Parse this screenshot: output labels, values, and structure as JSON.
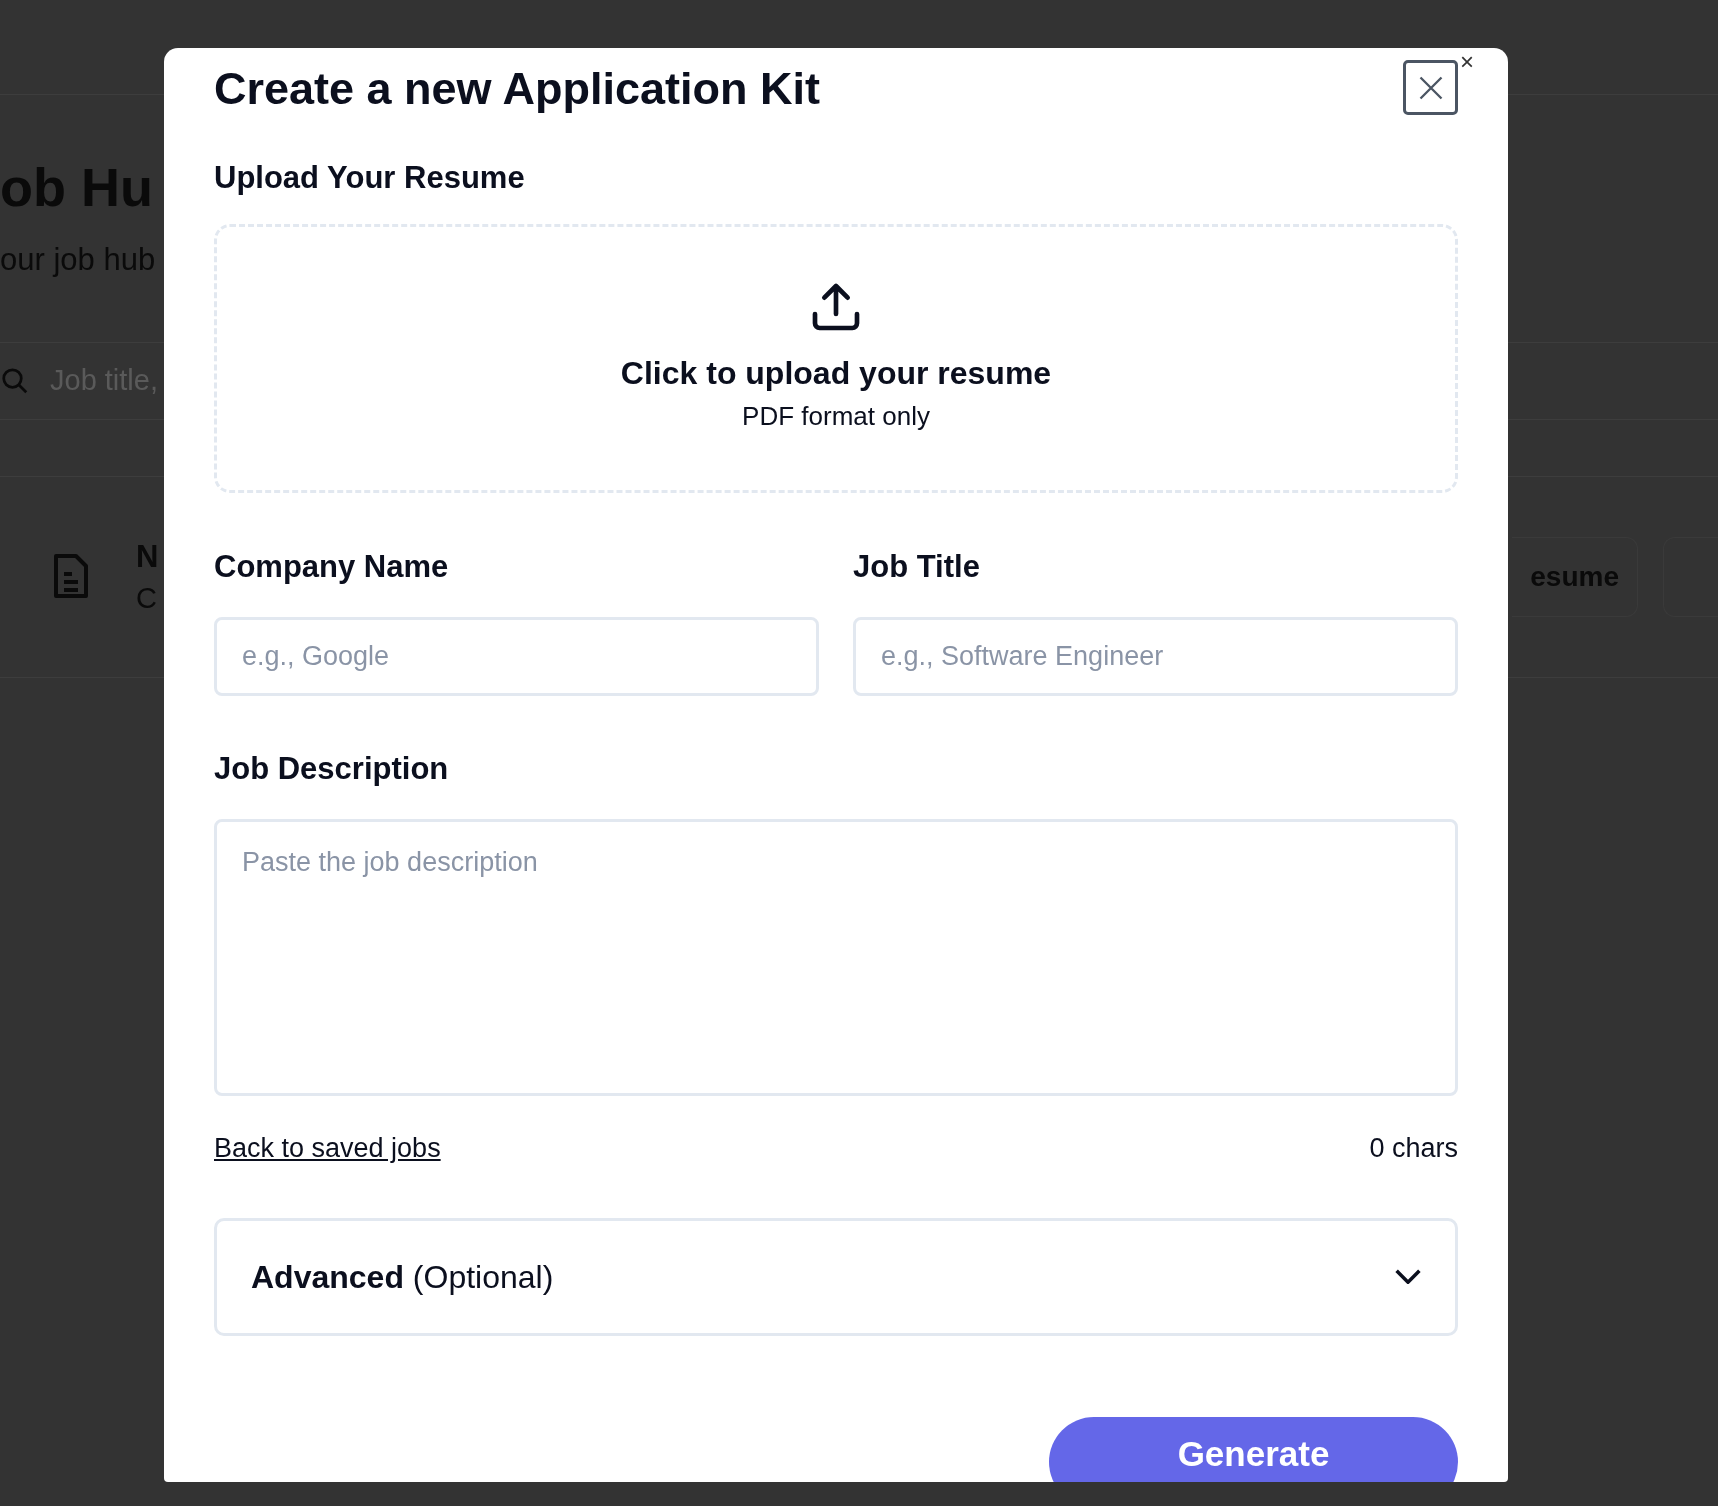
{
  "background_page": {
    "title": "ob Hu",
    "subtitle": "our job hub",
    "search": {
      "placeholder": "Job title,"
    },
    "job_row": {
      "title": "N",
      "subtitle": "C",
      "actions": [
        "esume"
      ]
    }
  },
  "dialog": {
    "title": "Create a new Application Kit",
    "close_label": "×",
    "upload": {
      "heading": "Upload Your Resume",
      "prompt": "Click to upload your resume",
      "hint": "PDF format only"
    },
    "fields": [
      {
        "label": "Company Name",
        "placeholder": "e.g., Google"
      },
      {
        "label": "Job Title",
        "placeholder": "e.g., Software Engineer"
      }
    ],
    "description": {
      "label": "Job Description",
      "placeholder": "Paste the job description"
    },
    "back_link": "Back to saved jobs",
    "char_count": "0 chars",
    "advanced": {
      "label": "**Advanced** (Optional)",
      "expanded": false
    },
    "primary_button": "Generate"
  }
}
